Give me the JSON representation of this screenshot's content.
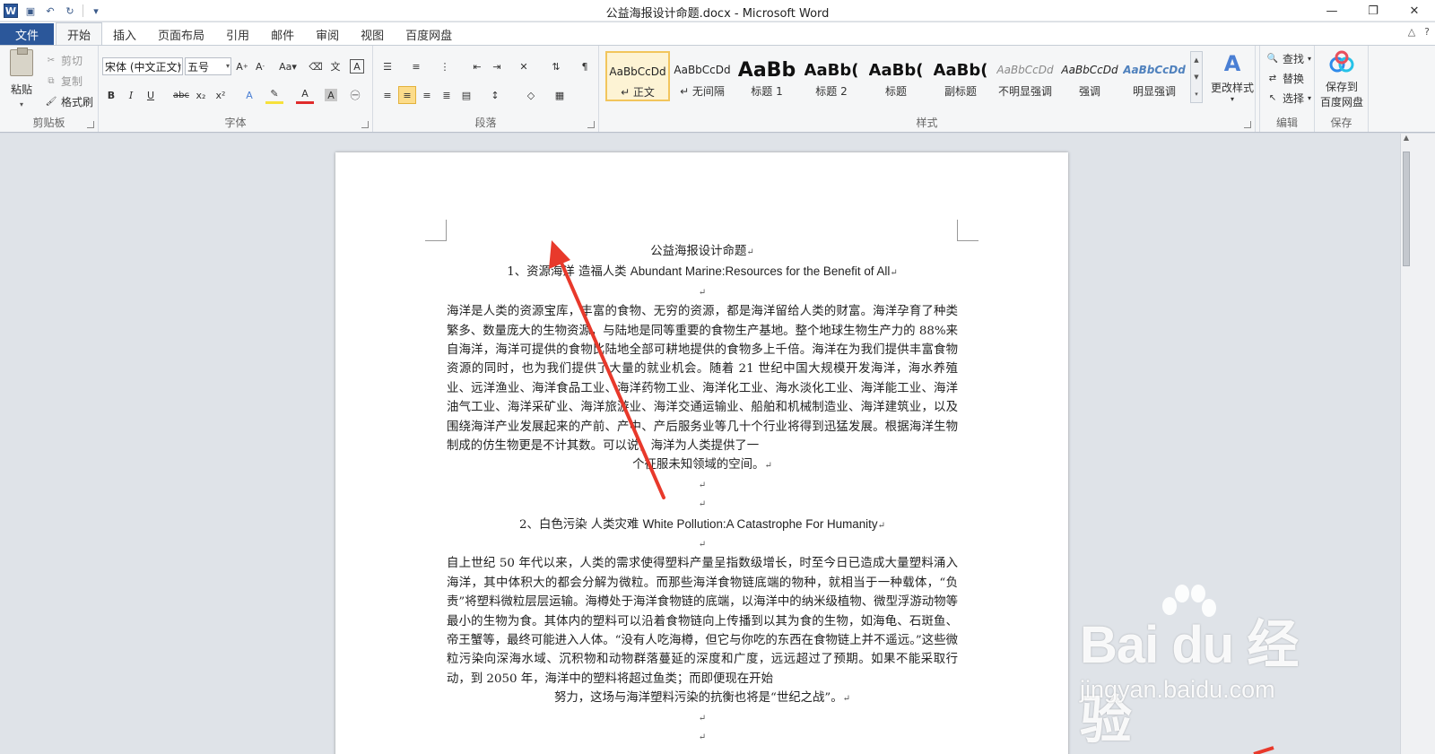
{
  "window": {
    "title": "公益海报设计命题.docx - Microsoft Word",
    "minimize": "—",
    "restore": "❐",
    "close": "✕"
  },
  "qat": {
    "app_icon": "W",
    "save": "💾",
    "undo": "↶",
    "redo": "↻",
    "customize": "▾"
  },
  "tabs": {
    "file": "文件",
    "items": [
      "开始",
      "插入",
      "页面布局",
      "引用",
      "邮件",
      "审阅",
      "视图",
      "百度网盘"
    ],
    "active": "开始",
    "collapse": "△",
    "help": "?"
  },
  "clipboard": {
    "paste": "粘贴",
    "cut": "剪切",
    "copy": "复制",
    "format_painter": "格式刷",
    "label": "剪贴板"
  },
  "font": {
    "family": "宋体 (中文正文)",
    "size": "五号",
    "label": "字体"
  },
  "paragraph": {
    "label": "段落"
  },
  "styles": {
    "label": "样式",
    "items": [
      {
        "preview": "AaBbCcDd",
        "name": "↵ 正文"
      },
      {
        "preview": "AaBbCcDd",
        "name": "↵ 无间隔"
      },
      {
        "preview": "AaBb",
        "name": "标题 1"
      },
      {
        "preview": "AaBb(",
        "name": "标题 2"
      },
      {
        "preview": "AaBb(",
        "name": "标题"
      },
      {
        "preview": "AaBb(",
        "name": "副标题"
      },
      {
        "preview": "AaBbCcDd",
        "name": "不明显强调"
      },
      {
        "preview": "AaBbCcDd",
        "name": "强调"
      },
      {
        "preview": "AaBbCcDd",
        "name": "明显强调"
      }
    ],
    "change": "更改样式"
  },
  "editing": {
    "find": "查找",
    "replace": "替换",
    "select": "选择",
    "label": "编辑"
  },
  "save_group": {
    "button_line1": "保存到",
    "button_line2": "百度网盘",
    "label": "保存"
  },
  "document": {
    "title": "公益海报设计命题",
    "h1_num": "1、资源海洋 造福人类 ",
    "h1_en": "Abundant Marine:Resources for the Benefit of All",
    "p1": "海洋是人类的资源宝库，丰富的食物、无穷的资源，都是海洋留给人类的财富。海洋孕育了种类繁多、数量庞大的生物资源，与陆地是同等重要的食物生产基地。整个地球生物生产力的 88%来自海洋，海洋可提供的食物比陆地全部可耕地提供的食物多上千倍。海洋在为我们提供丰富食物资源的同时，也为我们提供了大量的就业机会。随着 21 世纪中国大规模开发海洋，海水养殖业、远洋渔业、海洋食品工业、海洋药物工业、海洋化工业、海水淡化工业、海洋能工业、海洋油气工业、海洋采矿业、海洋旅游业、海洋交通运输业、船舶和机械制造业、海洋建筑业，以及围绕海洋产业发展起来的产前、产中、产后服务业等几十个行业将得到迅猛发展。根据海洋生物制成的仿生物更是不计其数。可以说，海洋为人类提供了一",
    "p1_last": "个征服未知领域的空间。",
    "h2_num": "2、白色污染 人类灾难 ",
    "h2_en": "White Pollution:A Catastrophe For Humanity",
    "p2": "自上世纪 50 年代以来，人类的需求使得塑料产量呈指数级增长，时至今日已造成大量塑料涌入海洋，其中体积大的都会分解为微粒。而那些海洋食物链底端的物种，就相当于一种载体，“负责”将塑料微粒层层运输。海樽处于海洋食物链的底端，以海洋中的纳米级植物、微型浮游动物等最小的生物为食。其体内的塑料可以沿着食物链向上传播到以其为食的生物，如海龟、石斑鱼、帝王蟹等，最终可能进入人体。“没有人吃海樽，但它与你吃的东西在食物链上并不遥远。”这些微粒污染向深海水域、沉积物和动物群落蔓延的深度和广度，远远超过了预期。如果不能采取行动，到 2050 年，海洋中的塑料将超过鱼类；而即便现在开始",
    "p2_last": "努力，这场与海洋塑料污染的抗衡也将是“世纪之战”。",
    "para_mark": "↵"
  },
  "watermark": {
    "logo": "Bai du 经验",
    "url": "jingyan.baidu.com"
  },
  "colors": {
    "file_tab": "#2b579a",
    "annotation_arrow": "#e8392b",
    "selected_style": "#f2c55c"
  }
}
